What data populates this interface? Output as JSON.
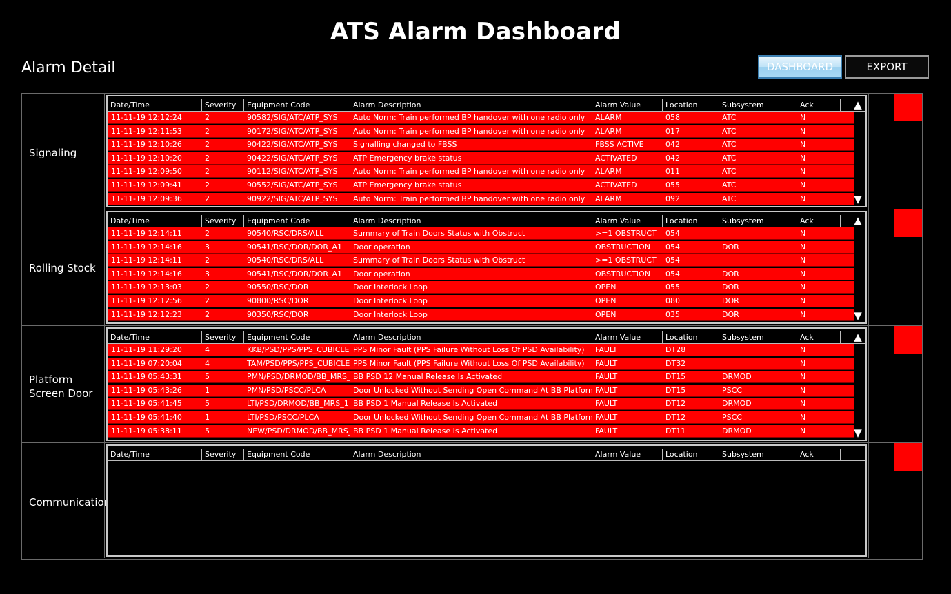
{
  "title": "ATS Alarm Dashboard",
  "subtitle": "Alarm Detail",
  "buttons": {
    "dashboard": "DASHBOARD",
    "export": "EXPORT"
  },
  "columns": [
    "Date/Time",
    "Severity",
    "Equipment Code",
    "Alarm Description",
    "Alarm Value",
    "Location",
    "Subsystem",
    "Ack"
  ],
  "colors": {
    "alarm_row": "#ff0000",
    "status_indicator": "#ff0000",
    "background": "#000000"
  },
  "sections": [
    {
      "label": "Signaling",
      "rows": [
        [
          "11-11-19 12:12:24",
          "2",
          "90582/SIG/ATC/ATP_SYS",
          "Auto Norm: Train performed BP handover with one radio only",
          "ALARM",
          "058",
          "ATC",
          "N"
        ],
        [
          "11-11-19 12:11:53",
          "2",
          "90172/SIG/ATC/ATP_SYS",
          "Auto Norm: Train performed BP handover with one radio only",
          "ALARM",
          "017",
          "ATC",
          "N"
        ],
        [
          "11-11-19 12:10:26",
          "2",
          "90422/SIG/ATC/ATP_SYS",
          "Signalling changed to FBSS",
          "FBSS ACTIVE",
          "042",
          "ATC",
          "N"
        ],
        [
          "11-11-19 12:10:20",
          "2",
          "90422/SIG/ATC/ATP_SYS",
          "ATP Emergency brake status",
          "ACTIVATED",
          "042",
          "ATC",
          "N"
        ],
        [
          "11-11-19 12:09:50",
          "2",
          "90112/SIG/ATC/ATP_SYS",
          "Auto Norm: Train performed BP handover with one radio only",
          "ALARM",
          "011",
          "ATC",
          "N"
        ],
        [
          "11-11-19 12:09:41",
          "2",
          "90552/SIG/ATC/ATP_SYS",
          "ATP Emergency brake status",
          "ACTIVATED",
          "055",
          "ATC",
          "N"
        ],
        [
          "11-11-19 12:09:36",
          "2",
          "90922/SIG/ATC/ATP_SYS",
          "Auto Norm: Train performed BP handover with one radio only",
          "ALARM",
          "092",
          "ATC",
          "N"
        ]
      ]
    },
    {
      "label": "Rolling Stock",
      "rows": [
        [
          "11-11-19 12:14:11",
          "2",
          "90540/RSC/DRS/ALL",
          "Summary of Train Doors Status with Obstruct",
          ">=1 OBSTRUCT",
          "054",
          "",
          "N"
        ],
        [
          "11-11-19 12:14:16",
          "3",
          "90541/RSC/DOR/DOR_A1",
          "Door operation",
          "OBSTRUCTION",
          "054",
          "DOR",
          "N"
        ],
        [
          "11-11-19 12:14:11",
          "2",
          "90540/RSC/DRS/ALL",
          "Summary of Train Doors Status with Obstruct",
          ">=1 OBSTRUCT",
          "054",
          "",
          "N"
        ],
        [
          "11-11-19 12:14:16",
          "3",
          "90541/RSC/DOR/DOR_A1",
          "Door operation",
          "OBSTRUCTION",
          "054",
          "DOR",
          "N"
        ],
        [
          "11-11-19 12:13:03",
          "2",
          "90550/RSC/DOR",
          "Door Interlock Loop",
          "OPEN",
          "055",
          "DOR",
          "N"
        ],
        [
          "11-11-19 12:12:56",
          "2",
          "90800/RSC/DOR",
          "Door Interlock Loop",
          "OPEN",
          "080",
          "DOR",
          "N"
        ],
        [
          "11-11-19 12:12:23",
          "2",
          "90350/RSC/DOR",
          "Door Interlock Loop",
          "OPEN",
          "035",
          "DOR",
          "N"
        ]
      ]
    },
    {
      "label": "Platform Screen Door",
      "rows": [
        [
          "11-11-19 11:29:20",
          "4",
          "KKB/PSD/PPS/PPS_CUBICLE",
          "PPS Minor Fault (PPS Failure Without Loss Of PSD Availability)",
          "FAULT",
          "DT28",
          "",
          "N"
        ],
        [
          "11-11-19 07:20:04",
          "4",
          "TAM/PSD/PPS/PPS_CUBICLE",
          "PPS Minor Fault (PPS Failure Without Loss Of PSD Availability)",
          "FAULT",
          "DT32",
          "",
          "N"
        ],
        [
          "11-11-19 05:43:31",
          "5",
          "PMN/PSD/DRMOD/BB_MRS_",
          "BB PSD 12 Manual Release Is Activated",
          "FAULT",
          "DT15",
          "DRMOD",
          "N"
        ],
        [
          "11-11-19 05:43:26",
          "1",
          "PMN/PSD/PSCC/PLCA",
          "Door Unlocked Without Sending Open Command At BB Platform",
          "FAULT",
          "DT15",
          "PSCC",
          "N"
        ],
        [
          "11-11-19 05:41:45",
          "5",
          "LTI/PSD/DRMOD/BB_MRS_1",
          "BB PSD 1 Manual Release Is Activated",
          "FAULT",
          "DT12",
          "DRMOD",
          "N"
        ],
        [
          "11-11-19 05:41:40",
          "1",
          "LTI/PSD/PSCC/PLCA",
          "Door Unlocked Without Sending Open Command At BB Platform",
          "FAULT",
          "DT12",
          "PSCC",
          "N"
        ],
        [
          "11-11-19 05:38:11",
          "5",
          "NEW/PSD/DRMOD/BB_MRS_",
          "BB PSD 1 Manual Release Is Activated",
          "FAULT",
          "DT11",
          "DRMOD",
          "N"
        ]
      ]
    },
    {
      "label": "Communication",
      "rows": []
    }
  ]
}
